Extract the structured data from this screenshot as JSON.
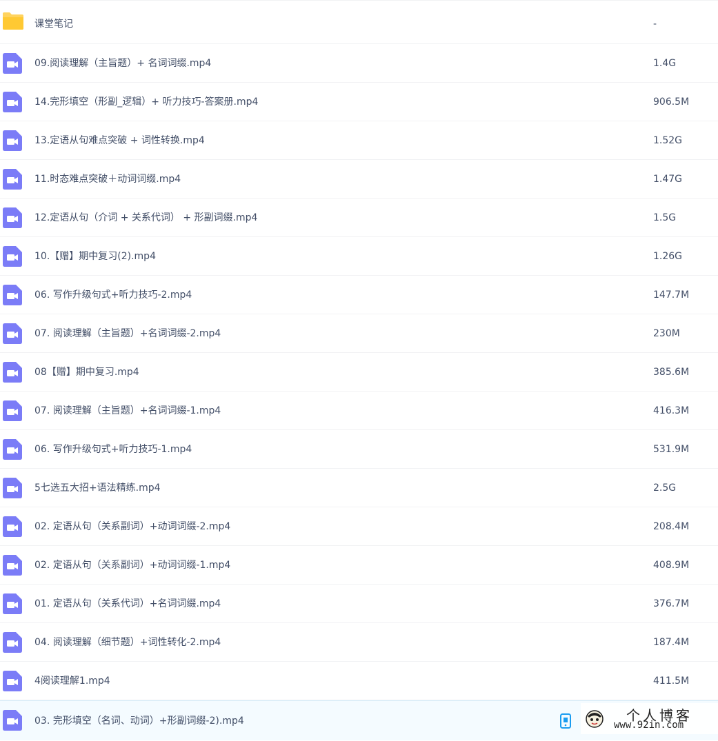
{
  "files": [
    {
      "name": "课堂笔记",
      "size": "-",
      "type": "folder"
    },
    {
      "name": "09.阅读理解（主旨题）+ 名词词缀.mp4",
      "size": "1.4G",
      "type": "video"
    },
    {
      "name": "14.完形填空（形副_逻辑）+ 听力技巧-答案册.mp4",
      "size": "906.5M",
      "type": "video"
    },
    {
      "name": "13.定语从句难点突破 + 词性转换.mp4",
      "size": "1.52G",
      "type": "video"
    },
    {
      "name": "11.时态难点突破＋动词词缀.mp4",
      "size": "1.47G",
      "type": "video"
    },
    {
      "name": "12.定语从句（介词 + 关系代词） + 形副词缀.mp4",
      "size": "1.5G",
      "type": "video"
    },
    {
      "name": "10.【赠】期中复习(2).mp4",
      "size": "1.26G",
      "type": "video"
    },
    {
      "name": "06. 写作升级句式+听力技巧-2.mp4",
      "size": "147.7M",
      "type": "video"
    },
    {
      "name": "07. 阅读理解（主旨题）+名词词缀-2.mp4",
      "size": "230M",
      "type": "video"
    },
    {
      "name": "08【赠】期中复习.mp4",
      "size": "385.6M",
      "type": "video"
    },
    {
      "name": "07. 阅读理解（主旨题）+名词词缀-1.mp4",
      "size": "416.3M",
      "type": "video"
    },
    {
      "name": "06. 写作升级句式+听力技巧-1.mp4",
      "size": "531.9M",
      "type": "video"
    },
    {
      "name": "5七选五大招+语法精练.mp4",
      "size": "2.5G",
      "type": "video"
    },
    {
      "name": "02. 定语从句（关系副词）+动词词缀-2.mp4",
      "size": "208.4M",
      "type": "video"
    },
    {
      "name": "02. 定语从句（关系副词）+动词词缀-1.mp4",
      "size": "408.9M",
      "type": "video"
    },
    {
      "name": "01. 定语从句（关系代词）+名词词缀.mp4",
      "size": "376.7M",
      "type": "video"
    },
    {
      "name": "04. 阅读理解（细节题）+词性转化-2.mp4",
      "size": "187.4M",
      "type": "video"
    },
    {
      "name": "4阅读理解1.mp4",
      "size": "411.5M",
      "type": "video"
    },
    {
      "name": "03. 完形填空（名词、动词）+形副词缀-2).mp4",
      "size": "",
      "type": "video"
    }
  ],
  "icons": {
    "folder": "folder-icon",
    "video": "video-file-icon",
    "phone": "phone-icon"
  },
  "colors": {
    "folder": "#ffd35e",
    "video": "#7b7cf7",
    "hover_row": "#f4fbff",
    "text": "#424e67",
    "phone": "#1a9cf0"
  },
  "watermark": {
    "title": "个人博客",
    "url": "www.92in.com"
  }
}
